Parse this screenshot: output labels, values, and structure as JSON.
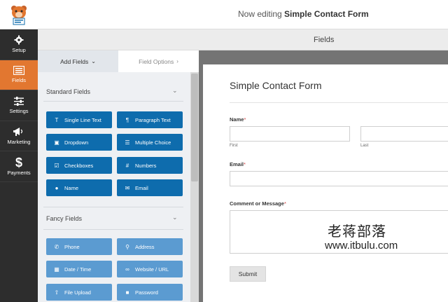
{
  "header": {
    "title_prefix": "Now editing",
    "form_name": "Simple Contact Form",
    "section_label": "Fields"
  },
  "sidebar": {
    "items": [
      {
        "label": "Setup",
        "icon": "gear-icon"
      },
      {
        "label": "Fields",
        "icon": "list-icon",
        "active": true
      },
      {
        "label": "Settings",
        "icon": "sliders-icon"
      },
      {
        "label": "Marketing",
        "icon": "megaphone-icon"
      },
      {
        "label": "Payments",
        "icon": "dollar-icon"
      }
    ]
  },
  "panel": {
    "tabs": [
      {
        "label": "Add Fields",
        "chevron": "⌄",
        "active": true
      },
      {
        "label": "Field Options",
        "chevron": "›",
        "active": false
      }
    ],
    "standard": {
      "title": "Standard Fields",
      "buttons": [
        {
          "label": "Single Line Text",
          "icon": "text-t-icon"
        },
        {
          "label": "Paragraph Text",
          "icon": "paragraph-icon"
        },
        {
          "label": "Dropdown",
          "icon": "dropdown-icon"
        },
        {
          "label": "Multiple Choice",
          "icon": "list-icon"
        },
        {
          "label": "Checkboxes",
          "icon": "checkbox-icon"
        },
        {
          "label": "Numbers",
          "icon": "hash-icon"
        },
        {
          "label": "Name",
          "icon": "user-icon"
        },
        {
          "label": "Email",
          "icon": "envelope-icon"
        }
      ]
    },
    "fancy": {
      "title": "Fancy Fields",
      "buttons": [
        {
          "label": "Phone",
          "icon": "phone-icon"
        },
        {
          "label": "Address",
          "icon": "map-pin-icon"
        },
        {
          "label": "Date / Time",
          "icon": "calendar-icon"
        },
        {
          "label": "Website / URL",
          "icon": "link-icon"
        },
        {
          "label": "File Upload",
          "icon": "upload-icon"
        },
        {
          "label": "Password",
          "icon": "lock-icon"
        }
      ]
    }
  },
  "form": {
    "title": "Simple Contact Form",
    "fields": {
      "name_label": "Name",
      "first_sublabel": "First",
      "last_sublabel": "Last",
      "email_label": "Email",
      "comment_label": "Comment or Message",
      "required_mark": "*"
    },
    "submit_label": "Submit"
  },
  "watermark": {
    "line1": "老蒋部落",
    "line2": "www.itbulu.com"
  },
  "colors": {
    "sidebar_bg": "#2d2d2d",
    "active_accent": "#e27730",
    "standard_button": "#0e6cad",
    "fancy_button": "#5b9bd1"
  }
}
